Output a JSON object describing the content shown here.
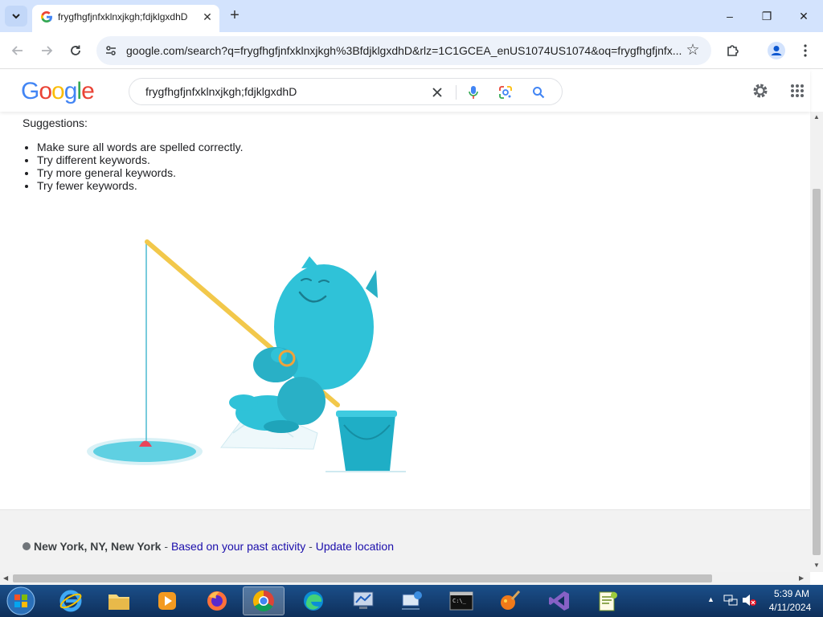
{
  "browser": {
    "tab_title": "frygfhgfjnfxklnxjkgh;fdjklgxdhD",
    "tab_close": "✕",
    "new_tab": "+",
    "url": "google.com/search?q=frygfhgfjnfxklnxjkgh%3BfdjklgxdhD&rlz=1C1GCEA_enUS1074US1074&oq=frygfhgfjnfx...",
    "window_buttons": {
      "minimize": "–",
      "restore": "❐",
      "close": "✕"
    }
  },
  "search": {
    "logo": "Google",
    "query": "frygfhgfjnfxklnxjkgh;fdjklgxdhD"
  },
  "results": {
    "suggestions_heading": "Suggestions:",
    "suggestions": [
      "Make sure all words are spelled correctly.",
      "Try different keywords.",
      "Try more general keywords.",
      "Try fewer keywords."
    ]
  },
  "footer": {
    "location": "New York, NY, New York",
    "separator": " - ",
    "based_on": "Based on your past activity",
    "update_location": "Update location"
  },
  "taskbar": {
    "time": "5:39 AM",
    "date": "4/11/2024",
    "apps": [
      "internet-explorer",
      "file-explorer",
      "media-player",
      "firefox",
      "chrome",
      "edge",
      "network-tool",
      "remote-desktop",
      "command-prompt",
      "paint",
      "visual-studio",
      "notepad-plus-plus"
    ]
  },
  "colors": {
    "tab_strip": "#d3e3fd",
    "omnibox": "#edf2fa",
    "link": "#1a0dab",
    "yeti": "#2fc2d8"
  }
}
